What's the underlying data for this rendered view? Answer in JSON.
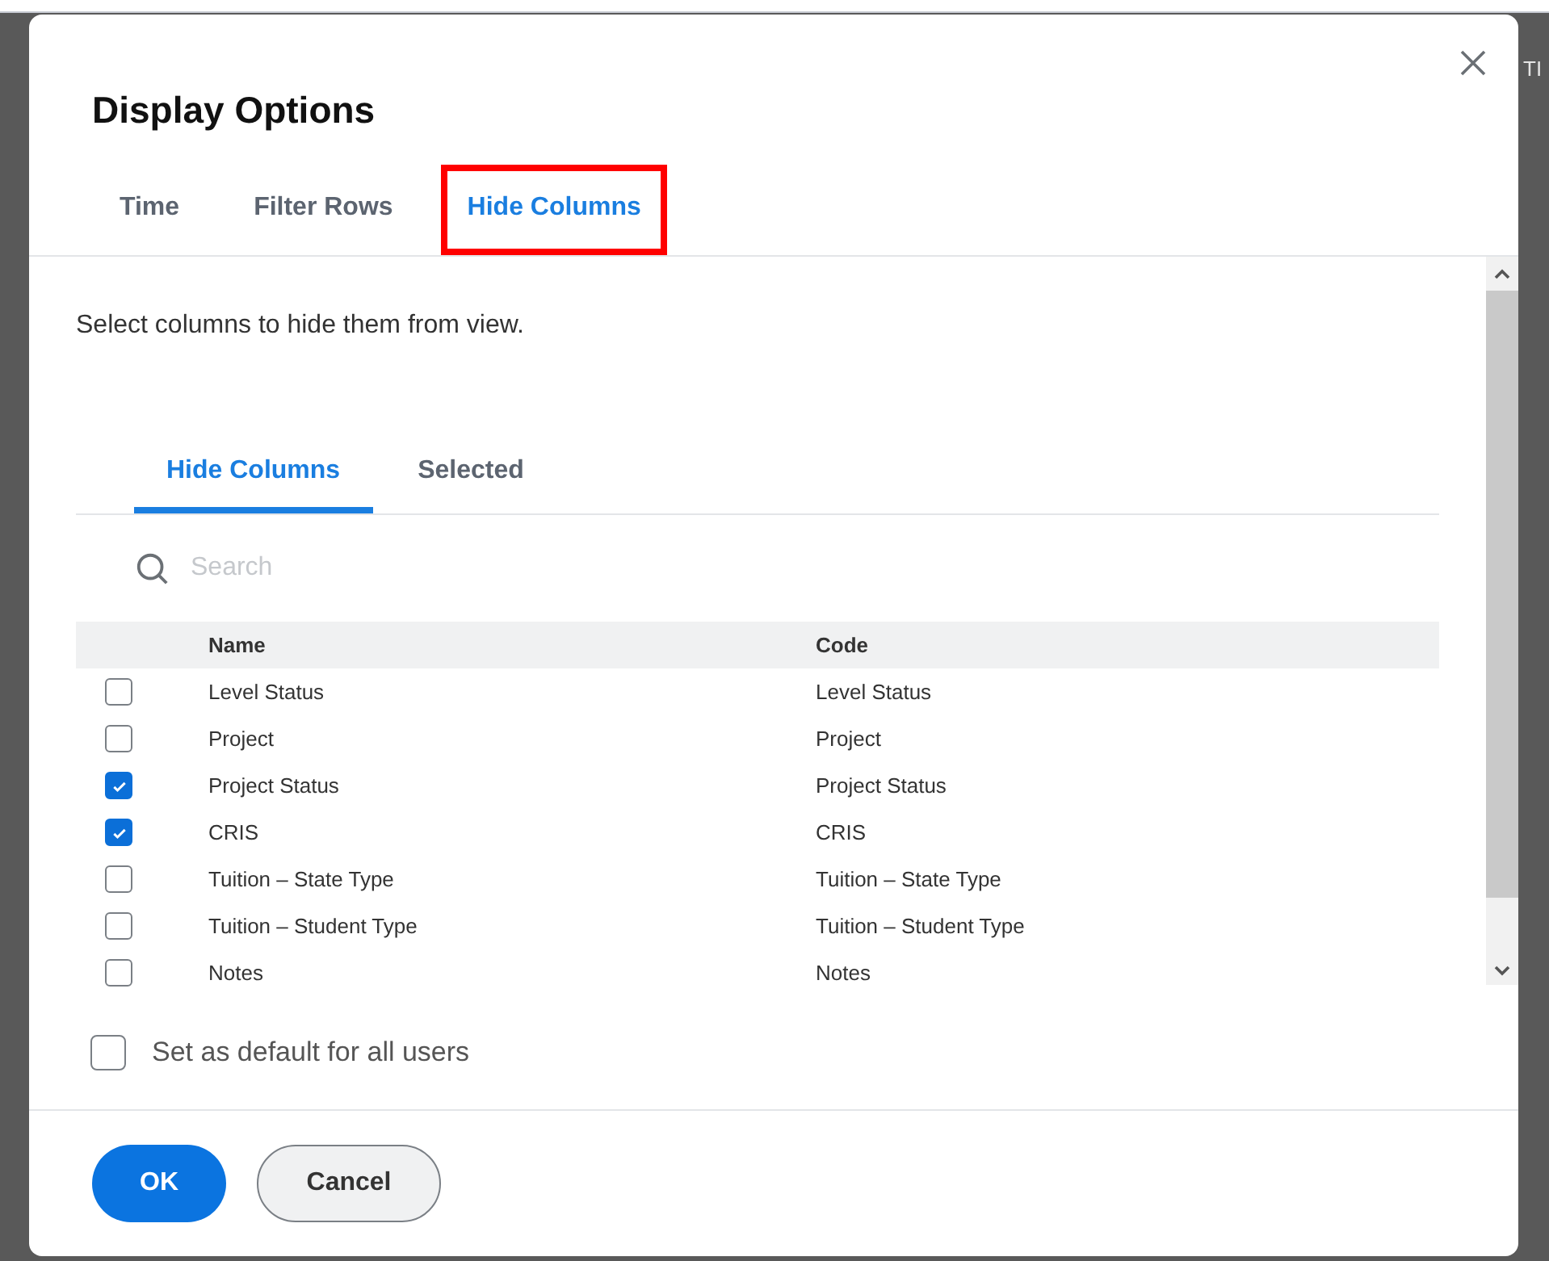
{
  "background": {
    "column_text": "TI"
  },
  "dialog": {
    "title": "Display Options"
  },
  "tabs": [
    {
      "label": "Time",
      "selected": false,
      "highlighted": false
    },
    {
      "label": "Filter Rows",
      "selected": false,
      "highlighted": false
    },
    {
      "label": "Hide Columns",
      "selected": true,
      "highlighted": true
    }
  ],
  "instructions": "Select columns to hide them from view.",
  "subtabs": [
    {
      "label": "Hide Columns",
      "selected": true
    },
    {
      "label": "Selected",
      "selected": false
    }
  ],
  "search": {
    "placeholder": "Search"
  },
  "table": {
    "columns": [
      "Name",
      "Code"
    ],
    "rows": [
      {
        "name": "Level Status",
        "code": "Level Status",
        "checked": false
      },
      {
        "name": "Project",
        "code": "Project",
        "checked": false
      },
      {
        "name": "Project Status",
        "code": "Project Status",
        "checked": true
      },
      {
        "name": "CRIS",
        "code": "CRIS",
        "checked": true
      },
      {
        "name": "Tuition – State Type",
        "code": "Tuition – State Type",
        "checked": false
      },
      {
        "name": "Tuition – Student Type",
        "code": "Tuition – Student Type",
        "checked": false
      },
      {
        "name": "Notes",
        "code": "Notes",
        "checked": false
      }
    ]
  },
  "default_option": {
    "label": "Set as default for all users",
    "checked": false
  },
  "buttons": [
    {
      "label": "OK",
      "kind": "primary"
    },
    {
      "label": "Cancel",
      "kind": "secondary"
    }
  ]
}
